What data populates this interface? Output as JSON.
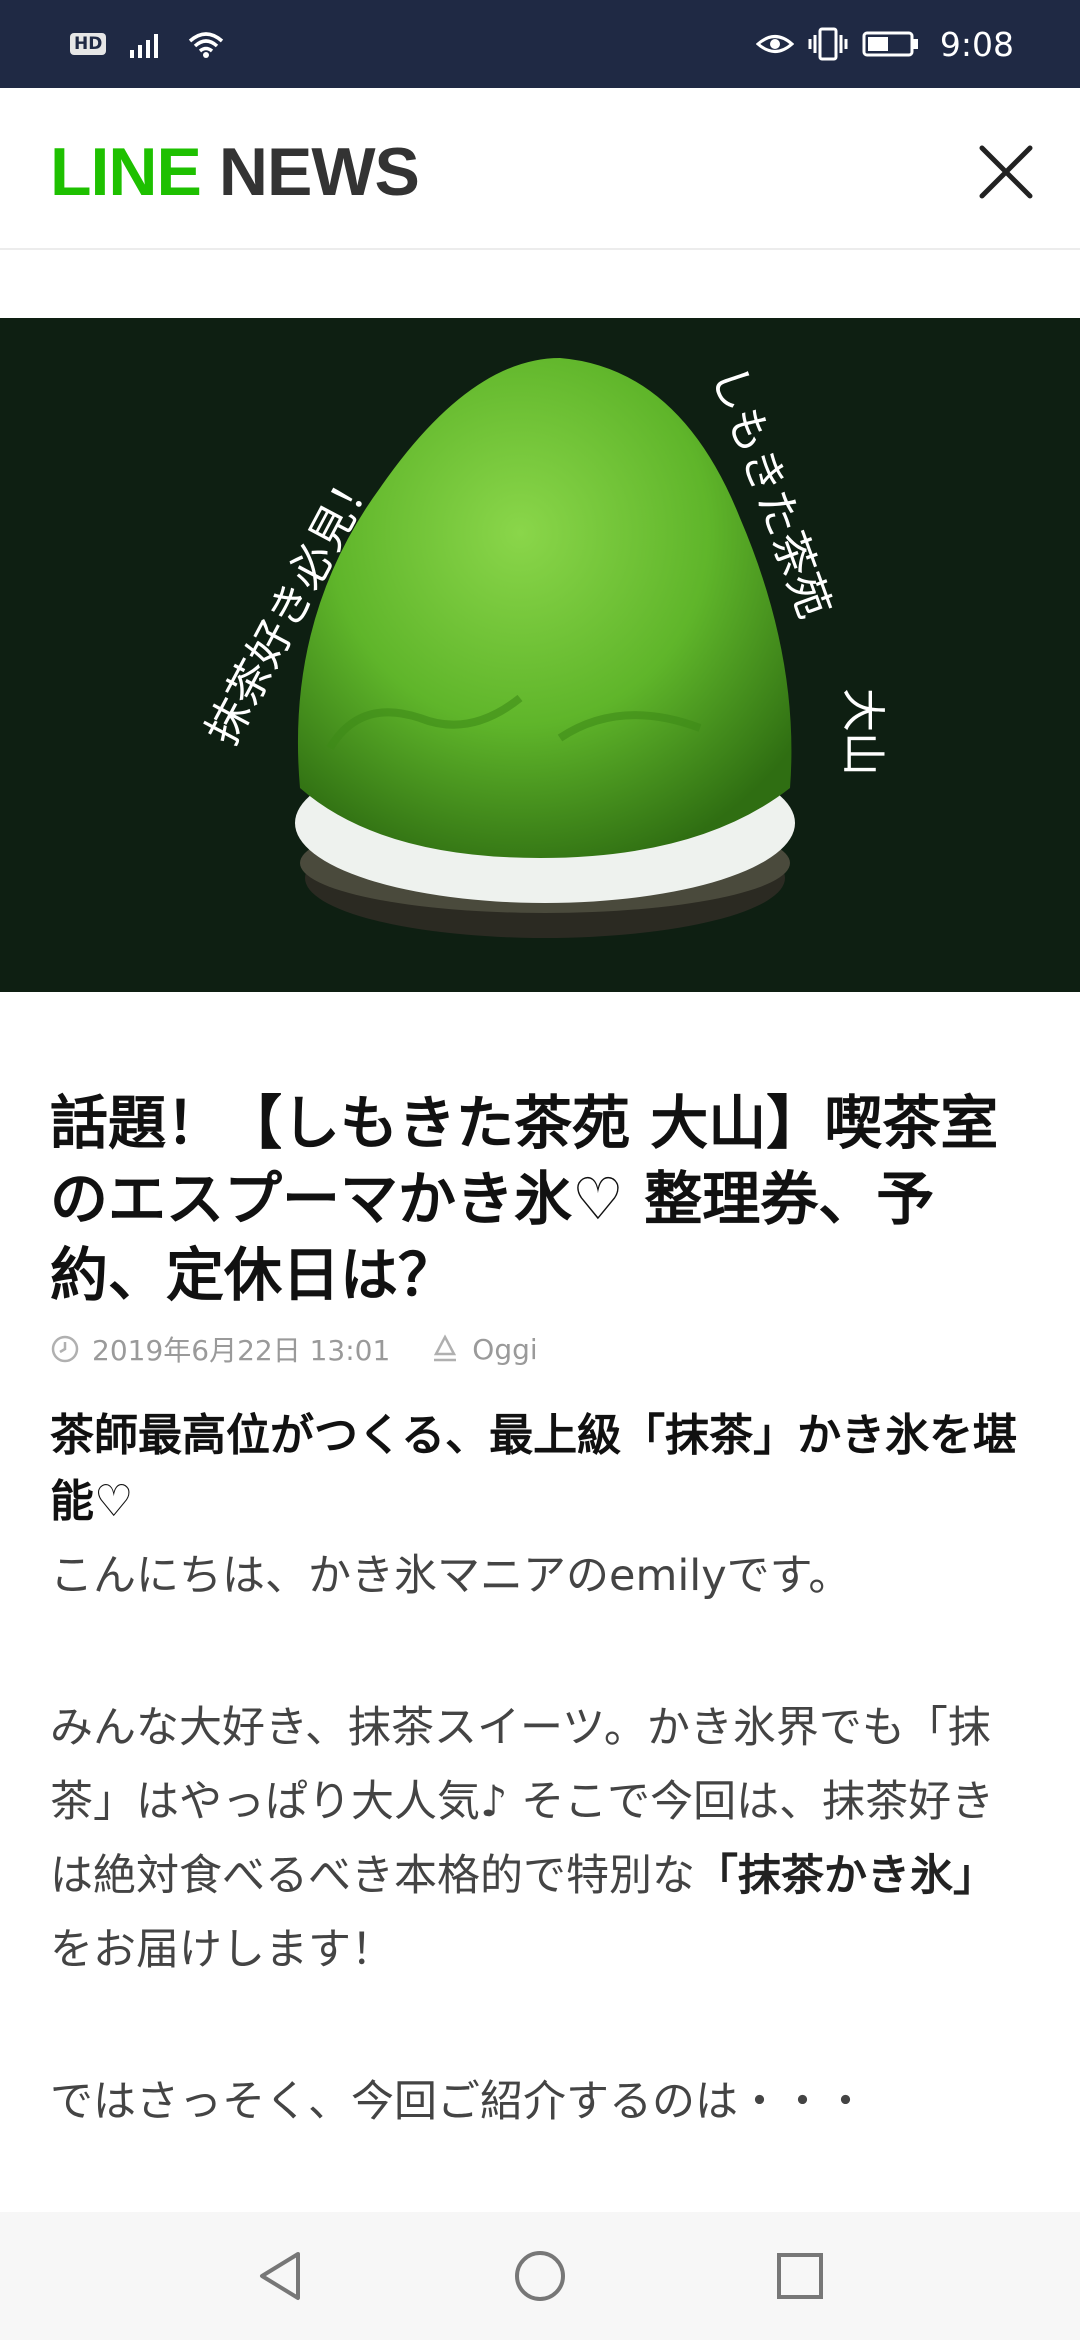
{
  "status_bar": {
    "hd_label": "HD",
    "time": "9:08",
    "icons": [
      "signal-icon",
      "wifi-icon",
      "eye-icon",
      "vibrate-icon",
      "battery-icon"
    ]
  },
  "app_bar": {
    "logo_line": "LINE",
    "logo_news": "NEWS",
    "close_icon": "close-icon"
  },
  "hero": {
    "text_left": "抹茶好き必見！",
    "text_right_1": "しもきた茶苑",
    "text_right_2": "大山"
  },
  "article": {
    "title": "話題！【しもきた茶苑 大山】喫茶室のエスプーマかき氷♡ 整理券、予約、定休日は？",
    "date": "2019年6月22日 13:01",
    "source": "Oggi",
    "subhead": "茶師最高位がつくる、最上級「抹茶」かき氷を堪能♡",
    "p1": "こんにちは、かき氷マニアのemilyです。",
    "p2_a": "みんな大好き、抹茶スイーツ。かき氷界でも「抹茶」はやっぱり大人気♪ そこで今回は、抹茶好きは絶対食べるべき本格的で特別な",
    "p2_bold": "「抹茶かき氷」",
    "p2_b": "をお届けします！",
    "p3": "ではさっそく、今回ご紹介するのは・・・"
  },
  "nav_bar": {
    "icons": [
      "back-icon",
      "home-icon",
      "recents-icon"
    ]
  },
  "colors": {
    "status_bg": "#1f2944",
    "line_green": "#1ec000",
    "hero_bg": "#0e1f12",
    "matcha": "#5fb52a"
  }
}
